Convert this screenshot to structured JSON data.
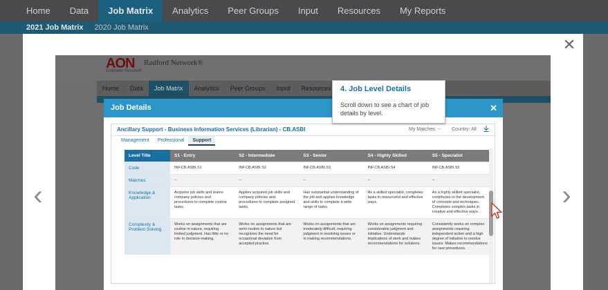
{
  "top_nav": {
    "items": [
      "Home",
      "Data",
      "Job Matrix",
      "Analytics",
      "Peer Groups",
      "Input",
      "Resources",
      "My Reports"
    ],
    "active": "Job Matrix"
  },
  "sub_nav": {
    "items": [
      "2021 Job Matrix",
      "2020 Job Matrix"
    ]
  },
  "outer_modal": {
    "close_glyph": "✕",
    "prev_glyph": "‹",
    "next_glyph": "›"
  },
  "frame": {
    "logo_text": "AON",
    "logo_tagline": "Empower Results®",
    "network_name": "Radford Network®",
    "nav_items": [
      "Home",
      "Data",
      "Job Matrix",
      "Analytics",
      "Peer Groups",
      "Input",
      "Resources"
    ]
  },
  "job_details": {
    "header_title": "Job Details",
    "close_glyph": "✕",
    "job_title": "Ancillary Support - Business Information Services (Librarian) - CB.ASBI",
    "matches_label": "My Matches: --",
    "country_label": "Country: All",
    "download_icon": "download-icon",
    "tabs": [
      "Management",
      "Professional",
      "Support"
    ],
    "active_tab": "Support",
    "table": {
      "headers": [
        "Level Title",
        "S1 - Entry",
        "S2 - Intermediate",
        "S3 - Senior",
        "S4 - Highly Skilled",
        "S5 - Specialist"
      ],
      "rows": [
        {
          "label": "Code",
          "cells": [
            "INF.CB.ASBI.S1",
            "INF.CB.ASBI.S2",
            "INF.CB.ASBI.S3",
            "INF.CB.ASBI.S4",
            "INF.CB.ASBI.S5"
          ]
        },
        {
          "label": "Matches",
          "cells": [
            "--",
            "--",
            "--",
            "--",
            "--"
          ]
        },
        {
          "label": "Knowledge & Application",
          "cells": [
            "Acquires job skills and learns company policies and procedures to complete routine tasks.",
            "Applies acquired job skills and company policies and procedures to complete assigned tasks.",
            "Has substantial understanding of the job and applies knowledge and skills to complete a wide range of tasks.",
            "As a skilled specialist, completes tasks in resourceful and effective ways.",
            "As a highly skilled specialist, contributes to the development of concepts and techniques. Completes complex tasks in creative and effective ways."
          ]
        },
        {
          "label": "Complexity & Problem Solving",
          "cells": [
            "Works on assignments that are routine in nature, requiring limited judgment. Has little or no role in decision-making.",
            "Works on assignments that are semi-routine in nature but recognizes the need for occasional deviation from accepted practice.",
            "Works on assignments that are moderately difficult, requiring judgment in resolving issues or in making recommendations.",
            "Works on assignments requiring considerable judgment and initiative. Understands implications of work and makes recommendations for solutions.",
            "Consistently works on complex assignments requiring independent action and a high degree of initiative to resolve issues. Makes recommendations for new procedures."
          ]
        }
      ]
    }
  },
  "tooltip": {
    "title": "4. Job Level Details",
    "body": "Scroll down to see a chart of job details by level."
  }
}
